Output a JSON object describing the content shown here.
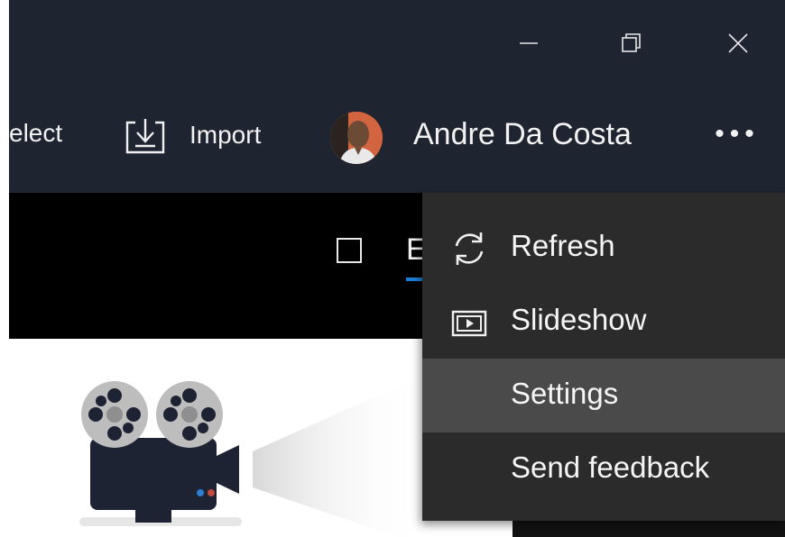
{
  "titlebar": {
    "minimize_icon": "minimize-icon",
    "restore_icon": "restore-icon",
    "close_icon": "close-icon"
  },
  "toolbar": {
    "select_label": "elect",
    "import_label": "Import",
    "import_icon": "import-icon",
    "user_name": "Andre Da Costa",
    "more_label": "•••"
  },
  "filter_bar": {
    "partial_label": "E"
  },
  "menu": {
    "items": [
      {
        "label": "Refresh",
        "icon": "refresh-icon"
      },
      {
        "label": "Slideshow",
        "icon": "slideshow-icon"
      },
      {
        "label": "Settings",
        "icon": ""
      },
      {
        "label": "Send feedback",
        "icon": ""
      }
    ],
    "highlighted": "Settings"
  },
  "colors": {
    "titlebar_bg": "#1f2530",
    "menu_bg": "#2b2b2b",
    "menu_hover": "#4a4a4a",
    "accent_blue": "#1e7fd6"
  }
}
